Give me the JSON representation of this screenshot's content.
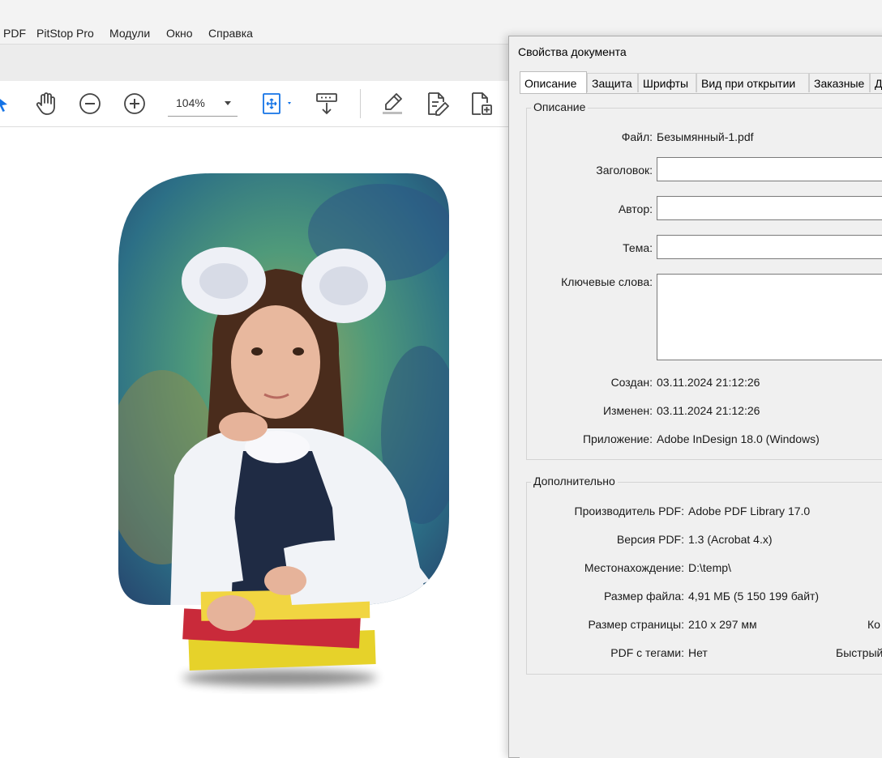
{
  "menu": [
    "PDF",
    "PitStop Pro",
    "Модули",
    "Окно",
    "Справка"
  ],
  "toolbar": {
    "zoom_value": "104%",
    "icons": [
      "select-arrow-icon",
      "hand-icon",
      "zoom-out-icon",
      "zoom-in-icon",
      "fit-page-icon",
      "scroll-down-icon",
      "highlight-pen-icon",
      "edit-pdf-icon",
      "page-attach-icon"
    ]
  },
  "colors": {
    "accent": "#1473e6",
    "dialog_bg": "#f0f0f0"
  },
  "dialog": {
    "title": "Свойства документа",
    "tabs": [
      "Описание",
      "Защита",
      "Шрифты",
      "Вид при открытии",
      "Заказные",
      "Д"
    ],
    "active_tab": "Описание",
    "description": {
      "group_title": "Описание",
      "file_label": "Файл:",
      "file_value": "Безымянный-1.pdf",
      "title_label": "Заголовок:",
      "title_value": "",
      "author_label": "Автор:",
      "author_value": "",
      "subject_label": "Тема:",
      "subject_value": "",
      "keywords_label": "Ключевые слова:",
      "keywords_value": "",
      "created_label": "Создан:",
      "created_value": "03.11.2024 21:12:26",
      "modified_label": "Изменен:",
      "modified_value": "03.11.2024 21:12:26",
      "app_label": "Приложение:",
      "app_value": "Adobe InDesign 18.0 (Windows)"
    },
    "advanced": {
      "group_title": "Дополнительно",
      "producer_label": "Производитель PDF:",
      "producer_value": "Adobe PDF Library 17.0",
      "version_label": "Версия PDF:",
      "version_value": "1.3 (Acrobat 4.x)",
      "location_label": "Местонахождение:",
      "location_value": "D:\\temp\\",
      "filesize_label": "Размер файла:",
      "filesize_value": "4,91 МБ (5 150 199 байт)",
      "pagesize_label": "Размер страницы:",
      "pagesize_value": "210 x 297 мм",
      "pagecount_label_partial": "Ко",
      "tagged_label": "PDF с тегами:",
      "tagged_value": "Нет",
      "fastweb_label_partial": "Быстрый"
    }
  }
}
